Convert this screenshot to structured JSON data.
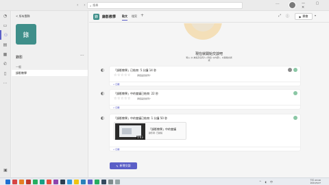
{
  "titlebar": {
    "search_placeholder": "搜尋",
    "more": "···",
    "window_controls": [
      "—",
      "▢",
      "✕"
    ]
  },
  "left_panel": {
    "back_label": "< 所有團隊",
    "team_logo_text": "錄",
    "team_name": "錄影",
    "more": "···",
    "general_label": "一般",
    "channel_label": "錄影教學"
  },
  "channel_header": {
    "logo_text": "錄",
    "title": "錄影教學",
    "tabs": [
      "貼文",
      "檔案"
    ],
    "add_tab": "+",
    "meet_label": "開會",
    "meet_chevron": "▾"
  },
  "prompt": {
    "title": "現在就開始交談吧",
    "subtitle": "輸入 @ 來提及任何人 (例如: @內部)，以開始交談\n或"
  },
  "messages": [
    {
      "header": "「錄影教學」已結束: 5 分鐘 14 秒",
      "rating_text": "通話品質如何?",
      "reply": "回覆"
    },
    {
      "header": "「錄影教學」中的會議已結束: 22 秒",
      "rating_text": "通話品質如何?",
      "reply": "回覆"
    },
    {
      "header": "「錄影教學」中的會議已結束: 1 分鐘 50 秒",
      "reply": "回覆",
      "recording": {
        "title": "「錄影教學」中的會議",
        "author": "錄影者: 已錄製",
        "duration": "1:43"
      }
    }
  ],
  "new_conversation_label": "新增交談",
  "stars": "☆☆☆☆☆",
  "taskbar": {
    "icon_colors": [
      "#1f6fd1",
      "#d64545",
      "#e67e22",
      "#c0392b",
      "#27ae60",
      "#16a085",
      "#e74c3c",
      "#8e44ad",
      "#2c3e50",
      "#3498db",
      "#f1c40f",
      "#2980b9",
      "#5b5fc7",
      "#27ae60",
      "#34495e",
      "#7f8c8d",
      "#95a5a6"
    ],
    "tray_text": "^ ◖ 中",
    "time": "下午 03:40",
    "date": "2021/5/27"
  },
  "colors": {
    "accent": "#5b5fc7",
    "team_logo": "#3f8f8a"
  }
}
